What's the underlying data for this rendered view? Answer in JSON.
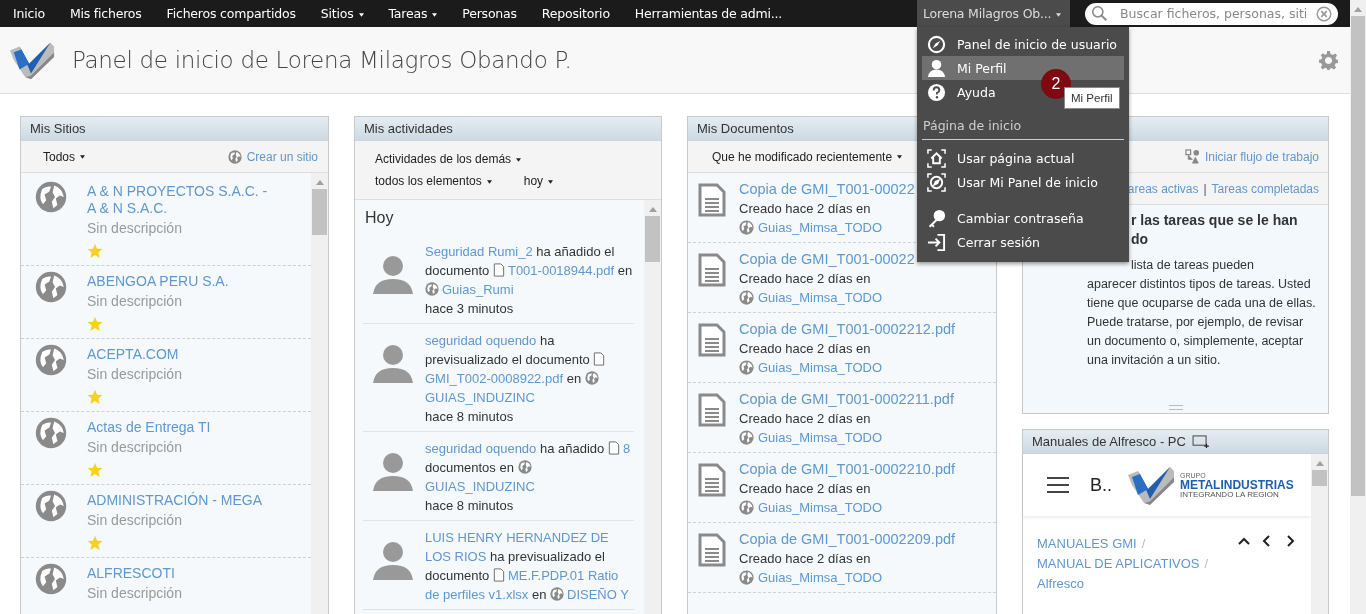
{
  "top_nav": {
    "items": [
      {
        "label": "Inicio",
        "dropdown": false
      },
      {
        "label": "Mis ficheros",
        "dropdown": false
      },
      {
        "label": "Ficheros compartidos",
        "dropdown": false
      },
      {
        "label": "Sitios",
        "dropdown": true
      },
      {
        "label": "Tareas",
        "dropdown": true
      },
      {
        "label": "Personas",
        "dropdown": false
      },
      {
        "label": "Repositorio",
        "dropdown": false
      },
      {
        "label": "Herramientas de admi...",
        "dropdown": false
      }
    ],
    "user_menu": {
      "label": "Lorena Milagros Ob...",
      "expanded": true,
      "badge": "2",
      "tooltip": "Mi Perfil",
      "groups": [
        {
          "items": [
            {
              "kind": "dashboard",
              "label": "Panel de inicio de usuario",
              "selected": false
            },
            {
              "kind": "profile",
              "label": "Mi Perfil",
              "selected": true
            },
            {
              "kind": "help",
              "label": "Ayuda",
              "selected": false
            }
          ]
        },
        {
          "heading": "Página de inicio",
          "items": [
            {
              "kind": "current-page",
              "label": "Usar página actual",
              "selected": false
            },
            {
              "kind": "my-dashboard",
              "label": "Usar Mi Panel de inicio",
              "selected": false
            }
          ]
        },
        {
          "items": [
            {
              "kind": "password",
              "label": "Cambiar contraseña",
              "selected": false
            },
            {
              "kind": "logout",
              "label": "Cerrar sesión",
              "selected": false
            }
          ]
        }
      ]
    },
    "search": {
      "placeholder": "Buscar ficheros, personas, siti"
    }
  },
  "page_header": {
    "title": "Panel de inicio de Lorena Milagros Obando P."
  },
  "my_sites": {
    "title": "Mis Sitios",
    "filter": "Todos",
    "action": "Crear un sitio",
    "sites": [
      {
        "name": "A & N PROYECTOS S.A.C. - A & N S.A.C.",
        "description": "Sin descripción",
        "favorite": true
      },
      {
        "name": "ABENGOA PERU S.A.",
        "description": "Sin descripción",
        "favorite": true
      },
      {
        "name": "ACEPTA.COM",
        "description": "Sin descripción",
        "favorite": true
      },
      {
        "name": "Actas de Entrega TI",
        "description": "Sin descripción",
        "favorite": true
      },
      {
        "name": "ADMINISTRACIÓN - MEGA",
        "description": "Sin descripción",
        "favorite": true
      },
      {
        "name": "ALFRESCOTI",
        "description": "Sin descripción"
      }
    ]
  },
  "my_activities": {
    "title": "Mis actividades",
    "filters": [
      "Actividades de los demás",
      "todos los elementos",
      "hoy"
    ],
    "day": "Hoy",
    "activities": [
      {
        "parts": [
          {
            "kind": "user",
            "text": "Seguridad Rumi_2"
          },
          {
            "kind": "text",
            "text": " ha añadido el documento "
          },
          {
            "kind": "doc",
            "text": "T001-0018944.pdf"
          },
          {
            "kind": "text",
            "text": " en "
          },
          {
            "kind": "site",
            "text": "Guias_Rumi"
          }
        ],
        "time": "hace 3 minutos"
      },
      {
        "parts": [
          {
            "kind": "user",
            "text": "seguridad oquendo"
          },
          {
            "kind": "text",
            "text": " ha previsualizado el documento "
          },
          {
            "kind": "doc",
            "text": "GMI_T002-0008922.pdf"
          },
          {
            "kind": "text",
            "text": " en "
          },
          {
            "kind": "site",
            "text": "GUIAS_INDUZINC"
          }
        ],
        "time": "hace 8 minutos"
      },
      {
        "parts": [
          {
            "kind": "user",
            "text": "seguridad oquendo"
          },
          {
            "kind": "text",
            "text": " ha añadido "
          },
          {
            "kind": "doc",
            "text": "8"
          },
          {
            "kind": "text",
            "text": " documentos en "
          },
          {
            "kind": "site",
            "text": "GUIAS_INDUZINC"
          }
        ],
        "time": "hace 8 minutos"
      },
      {
        "parts": [
          {
            "kind": "user",
            "text": "LUIS HENRY HERNANDEZ DE"
          },
          {
            "kind": "user",
            "text": "LOS RIOS"
          },
          {
            "kind": "text",
            "text": " ha previsualizado el documento "
          },
          {
            "kind": "doc",
            "text": "ME.F.PDP.01 Ratio"
          },
          {
            "kind": "doc-continued",
            "text": "de perfiles v1.xlsx"
          },
          {
            "kind": "text",
            "text": " en "
          },
          {
            "kind": "site",
            "text": "DISEÑO Y"
          }
        ]
      }
    ]
  },
  "my_documents": {
    "title": "Mis Documentos",
    "filter": "Que he modificado recientemente",
    "documents": [
      {
        "name": "Copia de GMI_T001-00022",
        "created": "Creado hace 2 días en",
        "site": "Guias_Mimsa_TODO"
      },
      {
        "name": "Copia de GMI_T001-00022",
        "created": "Creado hace 2 días en",
        "site": "Guias_Mimsa_TODO"
      },
      {
        "name": "Copia de GMI_T001-0002212.pdf",
        "created": "Creado hace 2 días en",
        "site": "Guias_Mimsa_TODO"
      },
      {
        "name": "Copia de GMI_T001-0002211.pdf",
        "created": "Creado hace 2 días en",
        "site": "Guias_Mimsa_TODO"
      },
      {
        "name": "Copia de GMI_T001-0002210.pdf",
        "created": "Creado hace 2 días en",
        "site": "Guias_Mimsa_TODO"
      },
      {
        "name": "Copia de GMI_T001-0002209.pdf",
        "created": "Creado hace 2 días en",
        "site": "Guias_Mimsa_TODO"
      }
    ]
  },
  "my_tasks": {
    "action": "Iniciar flujo de trabajo",
    "filters": [
      "areas activas",
      "Tareas completadas"
    ],
    "separator": "|",
    "heading": "r las tareas que se le han do",
    "paragraph": [
      "lista de tareas pueden",
      "aparecer distintos tipos de tareas. Usted tiene que ocuparse de cada una de ellas. Puede tratarse, por ejemplo, de revisar un documento o, simplemente, aceptar una invitación a un sitio."
    ]
  },
  "manuals": {
    "title": "Manuales de Alfresco - PC",
    "page_title": "B..",
    "logo": {
      "group": "GRUPO",
      "name": "METALINDUSTRIAS",
      "slogan": "INTEGRANDO LA REGION"
    },
    "separator": "/",
    "breadcrumb": [
      "MANUALES GMI",
      "MANUAL DE APLICATIVOS",
      "Alfresco"
    ]
  }
}
